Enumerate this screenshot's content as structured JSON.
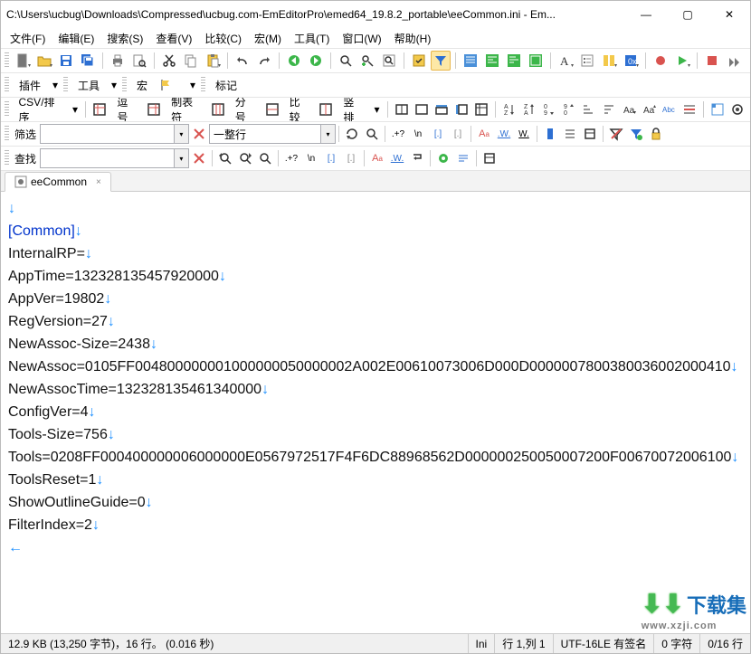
{
  "window": {
    "title": "C:\\Users\\ucbug\\Downloads\\Compressed\\ucbug.com-EmEditorPro\\emed64_19.8.2_portable\\eeCommon.ini - Em...",
    "min": "—",
    "max": "▢",
    "close": "✕"
  },
  "menu": [
    "文件(F)",
    "编辑(E)",
    "搜索(S)",
    "查看(V)",
    "比较(C)",
    "宏(M)",
    "工具(T)",
    "窗口(W)",
    "帮助(H)"
  ],
  "row2_labels": {
    "plugins": "插件",
    "tools": "工具",
    "macros": "宏",
    "marks": "标记"
  },
  "row3_labels": {
    "csv": "CSV/排序",
    "comma": "逗号",
    "tab": "制表符",
    "semi": "分号",
    "compare": "比较",
    "vsplit": "竖排"
  },
  "filter": {
    "label": "筛选",
    "value": "",
    "whole_line": "一整行"
  },
  "find": {
    "label": "查找",
    "value": ""
  },
  "tab": {
    "name": "eeCommon",
    "close": "×"
  },
  "editor_lines": [
    {
      "text": "",
      "cls": ""
    },
    {
      "text": "[Common]",
      "cls": "section"
    },
    {
      "text": "InternalRP=",
      "cls": ""
    },
    {
      "text": "AppTime=132328135457920000",
      "cls": ""
    },
    {
      "text": "AppVer=19802",
      "cls": ""
    },
    {
      "text": "RegVersion=27",
      "cls": ""
    },
    {
      "text": "NewAssoc-Size=2438",
      "cls": ""
    },
    {
      "text": "NewAssoc=0105FF004800000001000000050000002A002E00610073006D000D0000007800380036002000410",
      "cls": ""
    },
    {
      "text": "NewAssocTime=132328135461340000",
      "cls": ""
    },
    {
      "text": "ConfigVer=4",
      "cls": ""
    },
    {
      "text": "Tools-Size=756",
      "cls": ""
    },
    {
      "text": "Tools=0208FF000400000006000000E0567972517F4F6DC88968562D000000250050007200F00670072006100",
      "cls": ""
    },
    {
      "text": "ToolsReset=1",
      "cls": ""
    },
    {
      "text": "ShowOutlineGuide=0",
      "cls": ""
    },
    {
      "text": "FilterIndex=2",
      "cls": ""
    }
  ],
  "eol_glyph": "↓",
  "eof_glyph": "←",
  "status": {
    "left": "12.9 KB (13,250 字节)，16 行。 (0.016 秒)",
    "filetype": "Ini",
    "pos": "行 1,列 1",
    "encoding": "UTF-16LE 有签名",
    "chars": "0 字符",
    "lines": "0/16 行"
  },
  "watermark": {
    "arrow": "⬇⬇",
    "brand": "下载集",
    "url": "www.xzji.com"
  }
}
